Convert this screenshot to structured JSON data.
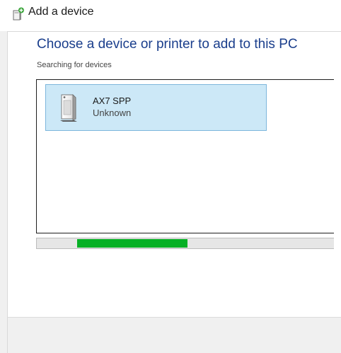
{
  "window": {
    "title": "Add a device",
    "icon": "add-device-icon"
  },
  "main": {
    "heading": "Choose a device or printer to add to this PC",
    "status_text": "Searching for devices"
  },
  "devices": [
    {
      "name": "AX7 SPP",
      "status": "Unknown",
      "icon": "generic-device-icon",
      "selected": true
    }
  ],
  "progress": {
    "indeterminate": true,
    "color": "#06b025"
  },
  "colors": {
    "heading": "#1a3e8c",
    "selection_bg": "#cce8f7",
    "selection_border": "#7db6dc"
  }
}
